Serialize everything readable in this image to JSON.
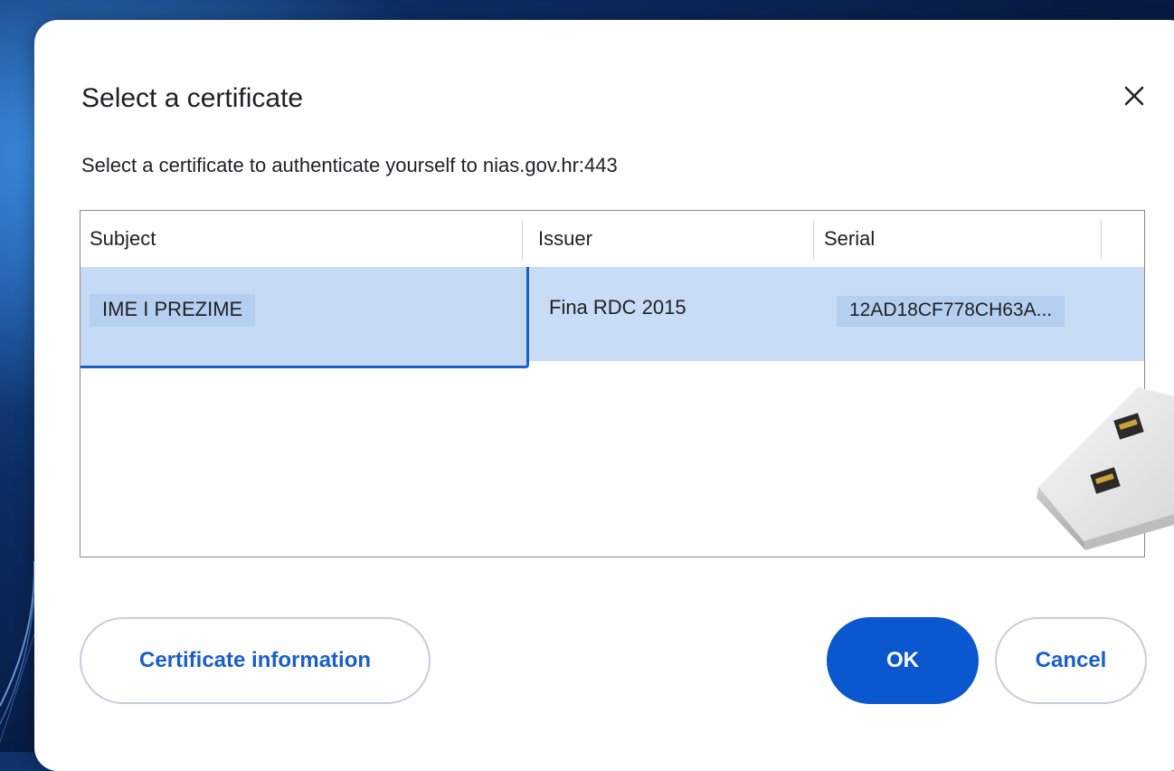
{
  "dialog": {
    "title": "Select a certificate",
    "subtitle": "Select a certificate to authenticate yourself to nias.gov.hr:443"
  },
  "table": {
    "columns": [
      "Subject",
      "Issuer",
      "Serial"
    ],
    "rows": [
      {
        "subject": "IME I PREZIME",
        "issuer": "Fina RDC 2015",
        "serial": "12AD18CF778CH63A...",
        "selected": true
      }
    ]
  },
  "buttons": {
    "certificate_info": "Certificate information",
    "ok": "OK",
    "cancel": "Cancel"
  },
  "colors": {
    "accent": "#0b57d0",
    "selection": "#c8dcf5",
    "background": "#0c2d63"
  },
  "icons": {
    "close": "close-icon",
    "device": "usb-token-icon"
  }
}
